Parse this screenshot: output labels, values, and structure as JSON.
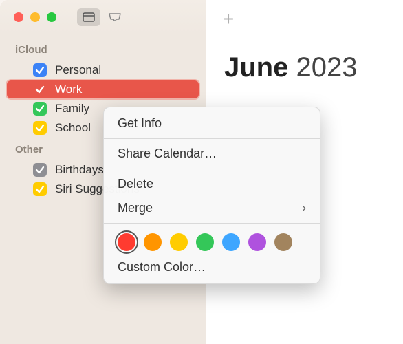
{
  "traffic": {
    "close": "#ff5f57",
    "min": "#febc2e",
    "max": "#28c840"
  },
  "month": {
    "name": "June",
    "year": "2023"
  },
  "sidebar": {
    "sections": [
      {
        "title": "iCloud",
        "items": [
          {
            "label": "Personal",
            "color": "#3b82f6",
            "selected": false
          },
          {
            "label": "Work",
            "color": "#e8564a",
            "selected": true
          },
          {
            "label": "Family",
            "color": "#34c759",
            "selected": false
          },
          {
            "label": "School",
            "color": "#ffcc00",
            "selected": false
          }
        ]
      },
      {
        "title": "Other",
        "items": [
          {
            "label": "Birthdays",
            "color": "#8e8e93",
            "selected": false
          },
          {
            "label": "Siri Suggestions",
            "color": "#ffcc00",
            "selected": false
          }
        ]
      }
    ]
  },
  "menu": {
    "get_info": "Get Info",
    "share": "Share Calendar…",
    "delete": "Delete",
    "merge": "Merge",
    "custom": "Custom Color…",
    "swatches": [
      "#ff3b30",
      "#ff9500",
      "#ffcc00",
      "#34c759",
      "#3ea6ff",
      "#af52de",
      "#a2845e"
    ],
    "selected_swatch": 0
  }
}
